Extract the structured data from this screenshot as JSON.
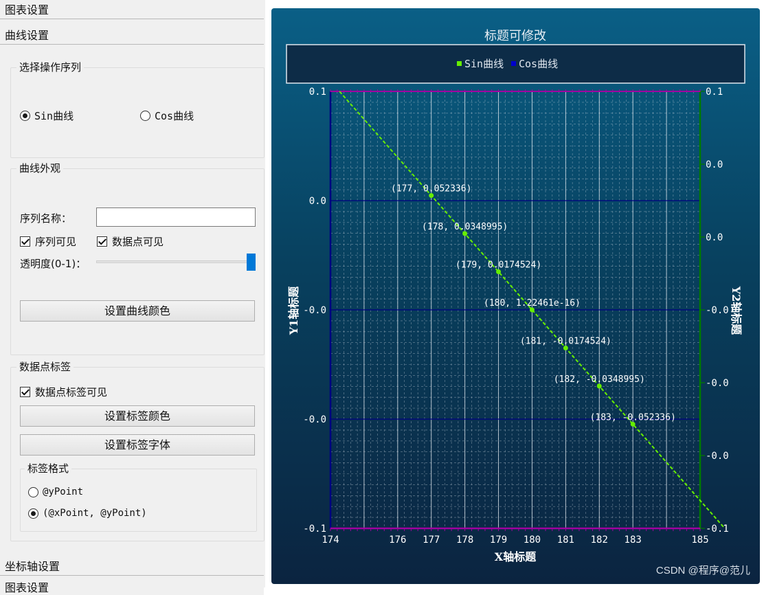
{
  "sections": {
    "chart_settings": "图表设置",
    "curve_settings": "曲线设置",
    "axis_settings": "坐标轴设置",
    "partial_next": "图表设置"
  },
  "series_select": {
    "title": "选择操作序列",
    "options": [
      "Sin曲线",
      "Cos曲线"
    ],
    "selected": "Sin曲线"
  },
  "appearance": {
    "title": "曲线外观",
    "name_label": "序列名称：",
    "name_value": "",
    "visible_label": "序列可见",
    "visible_checked": true,
    "points_visible_label": "数据点可见",
    "points_visible_checked": true,
    "opacity_label": "透明度(0-1)：",
    "opacity_value": 1.0,
    "color_button": "设置曲线颜色"
  },
  "point_labels": {
    "title": "数据点标签",
    "visible_label": "数据点标签可见",
    "visible_checked": true,
    "color_button": "设置标签颜色",
    "font_button": "设置标签字体",
    "format_title": "标签格式",
    "format_options": [
      "@yPoint",
      "(@xPoint, @yPoint)"
    ],
    "format_selected": "(@xPoint, @yPoint)"
  },
  "watermark": "CSDN @程序@范儿",
  "colors": {
    "sin": "#66ee00",
    "cos": "#0000cc",
    "y1_axis": "#000080",
    "y2_axis": "#007a00",
    "x_axis": "#a000a0"
  },
  "chart_data": {
    "type": "line",
    "title": "标题可修改",
    "xlabel": "X轴标题",
    "ylabel": "Y1轴标题",
    "y2label": "Y2轴标题",
    "xlim": [
      174,
      185
    ],
    "ylim": [
      -0.1,
      0.1
    ],
    "x_ticks": [
      "174",
      "175",
      "176",
      "177",
      "178",
      "179",
      "180",
      "181",
      "182",
      "183",
      "184",
      "185"
    ],
    "x_tick_labels_shown": [
      "174",
      "176",
      "177",
      "178",
      "179",
      "180",
      "181",
      "182",
      "183",
      "185"
    ],
    "y1_ticks": [
      "0.1",
      "0.0",
      "-0.0",
      "-0.0",
      "-0.1"
    ],
    "y2_ticks": [
      "0.1",
      "0.0",
      "0.0",
      "-0.0",
      "-0.0",
      "-0.0",
      "-0.1"
    ],
    "legend": [
      "Sin曲线",
      "Cos曲线"
    ],
    "legend_position": "top",
    "grid": true,
    "series": [
      {
        "name": "Sin曲线",
        "x": [
          177,
          178,
          179,
          180,
          181,
          182,
          183
        ],
        "y": [
          0.052336,
          0.0348995,
          0.0174524,
          1.22461e-16,
          -0.0174524,
          -0.0348995,
          -0.052336
        ],
        "labels": [
          "(177, 0.052336)",
          "(178, 0.0348995)",
          "(179, 0.0174524)",
          "(180, 1.22461e-16)",
          "(181, -0.0174524)",
          "(182, -0.0348995)",
          "(183, -0.052336)"
        ]
      }
    ]
  }
}
